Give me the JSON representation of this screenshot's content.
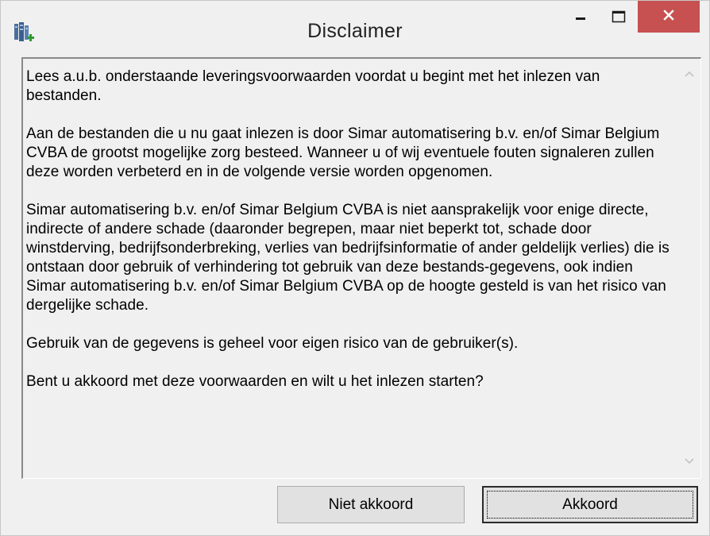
{
  "window": {
    "title": "Disclaimer",
    "close_color": "#c75050"
  },
  "icons": {
    "app": "database-add-icon",
    "minimize": "minimize-icon",
    "maximize": "maximize-icon",
    "close": "close-icon",
    "scroll_up": "chevron-up-icon",
    "scroll_down": "chevron-down-icon"
  },
  "message": {
    "paragraphs": [
      "Lees a.u.b. onderstaande leveringsvoorwaarden voordat u begint met het inlezen van bestanden.",
      "Aan de bestanden die u nu gaat inlezen is door Simar automatisering b.v. en/of Simar Belgium CVBA de grootst mogelijke zorg besteed. Wanneer u of wij eventuele fouten signaleren zullen deze worden verbeterd en in de volgende versie worden opgenomen.",
      "Simar automatisering b.v. en/of Simar Belgium CVBA is niet aansprakelijk voor enige directe, indirecte of andere schade (daaronder begrepen, maar niet beperkt tot, schade door winstderving, bedrijfsonderbreking, verlies van bedrijfsinformatie of ander geldelijk verlies) die is ontstaan door gebruik of verhindering tot gebruik van deze bestands-gegevens, ook indien Simar automatisering b.v. en/of Simar Belgium CVBA op de hoogte gesteld is van het risico van dergelijke schade.",
      "Gebruik van de gegevens is geheel voor eigen risico van de gebruiker(s).",
      "Bent u akkoord met deze voorwaarden en wilt u het inlezen starten?"
    ]
  },
  "buttons": {
    "decline": "Niet akkoord",
    "accept": "Akkoord"
  }
}
